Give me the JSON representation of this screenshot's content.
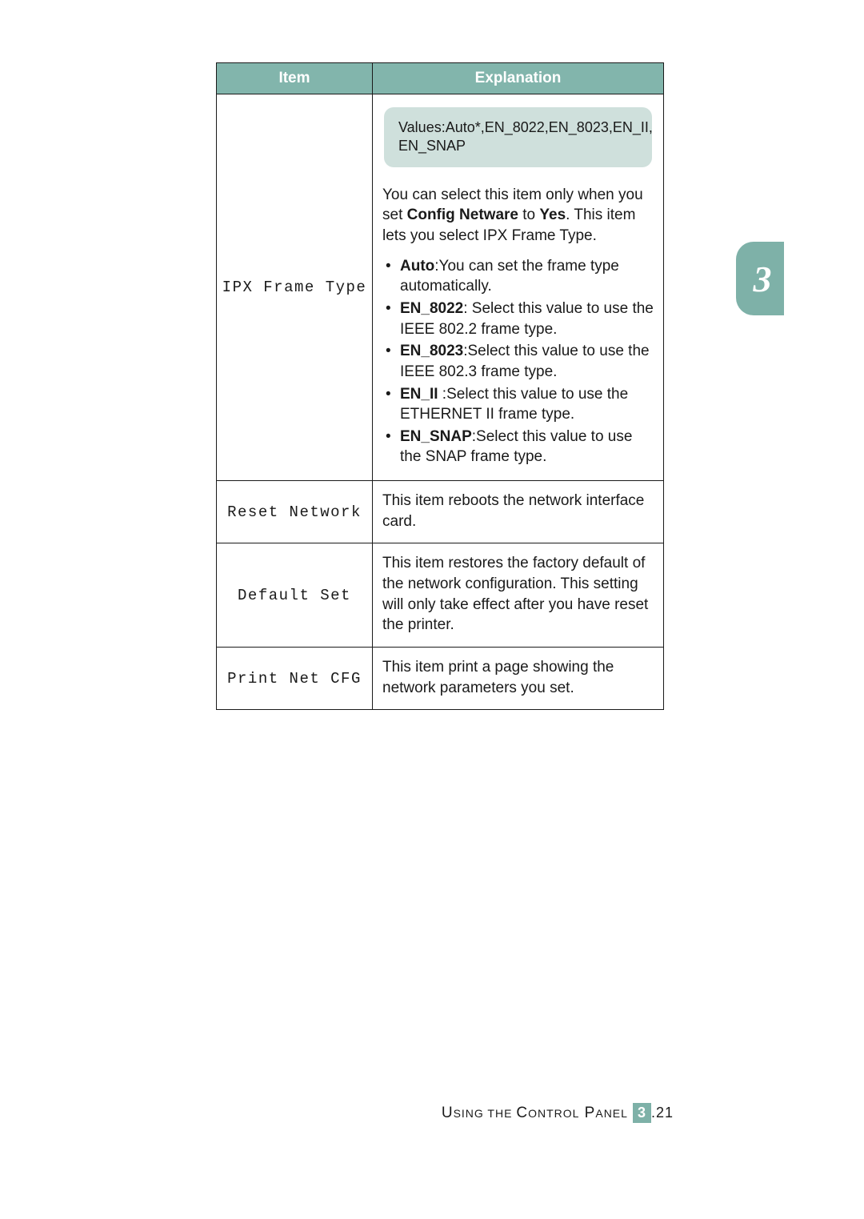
{
  "table": {
    "headers": {
      "item": "Item",
      "explanation": "Explanation"
    },
    "rows": [
      {
        "item": "IPX Frame Type",
        "values_box": "Values:Auto*,EN_8022,EN_8023,EN_II, EN_SNAP",
        "intro_pre": "You can select this item only when you set ",
        "intro_bold": "Config Netware",
        "intro_mid": " to ",
        "intro_bold2": "Yes",
        "intro_post": ". This item lets you select IPX Frame Type.",
        "bullets": [
          {
            "label": "Auto",
            "text": ":You can set the frame type automatically."
          },
          {
            "label": "EN_8022",
            "text": ": Select this value to use the IEEE 802.2 frame type."
          },
          {
            "label": "EN_8023",
            "text": ":Select this value to use the IEEE 802.3 frame type."
          },
          {
            "label": "EN_II",
            "text": " :Select this value to use the ETHERNET II frame type."
          },
          {
            "label": "EN_SNAP",
            "text": ":Select this value to use the SNAP frame type."
          }
        ]
      },
      {
        "item": "Reset Network",
        "text": "This item reboots the network interface card."
      },
      {
        "item": "Default Set",
        "text": "This item restores the factory default of the network configuration. This setting will only take effect after you have reset the printer."
      },
      {
        "item": "Print Net CFG",
        "text": "This item print a page showing the network parameters you set."
      }
    ]
  },
  "side_tab": "3",
  "footer": {
    "text_using": "U",
    "text_sing": "SING",
    "text_the": " THE ",
    "text_c": "C",
    "text_ontrol": "ONTROL",
    "text_p": " P",
    "text_anel": "ANEL",
    "chapter": "3",
    "dot": ".",
    "page": "21"
  }
}
